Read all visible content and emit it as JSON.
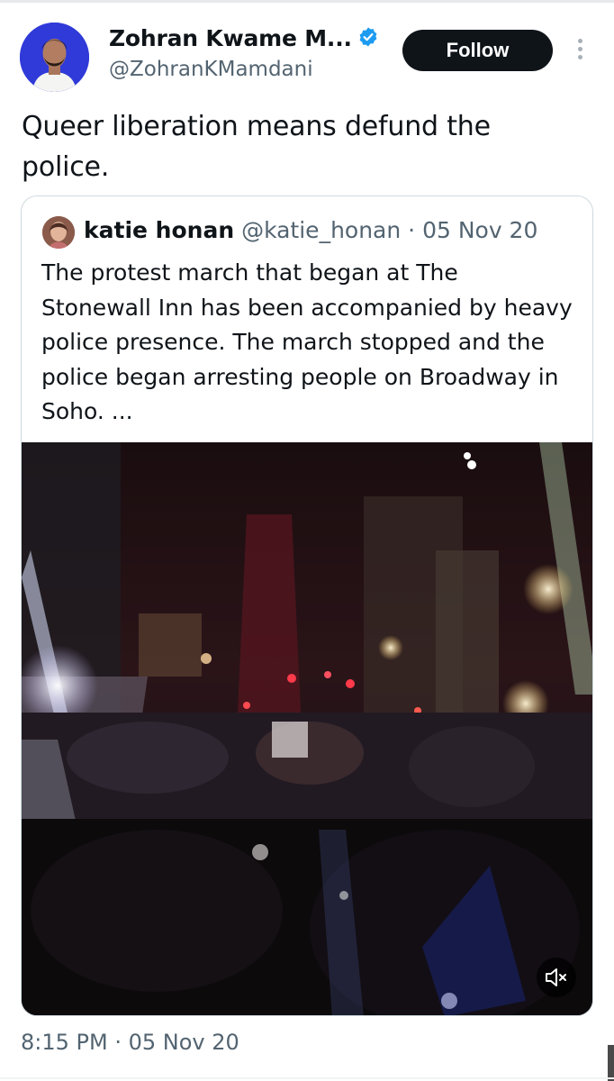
{
  "author": {
    "display_name": "Zohran Kwame M...",
    "handle": "@ZohranKMamdani",
    "verified": true,
    "avatar_bg": "#2f3ad8"
  },
  "follow_label": "Follow",
  "tweet_text": "Queer liberation means defund the police.",
  "quoted": {
    "name": "katie honan",
    "handle": "@katie_honan",
    "date": "· 05 Nov 20",
    "text": "The protest march that began at The Stonewall Inn has been accompanied by heavy police presence. The march stopped and the police began arresting people on Broadway in Soho. ..."
  },
  "timestamp": "8:15 PM · 05 Nov 20",
  "icons": {
    "verified": "verified-badge-icon",
    "more": "more-vertical-icon",
    "mute": "volume-muted-icon"
  },
  "colors": {
    "verified": "#1d9bf0",
    "button_bg": "#0f1419",
    "secondary_text": "#536471",
    "border": "#cfd9de"
  }
}
